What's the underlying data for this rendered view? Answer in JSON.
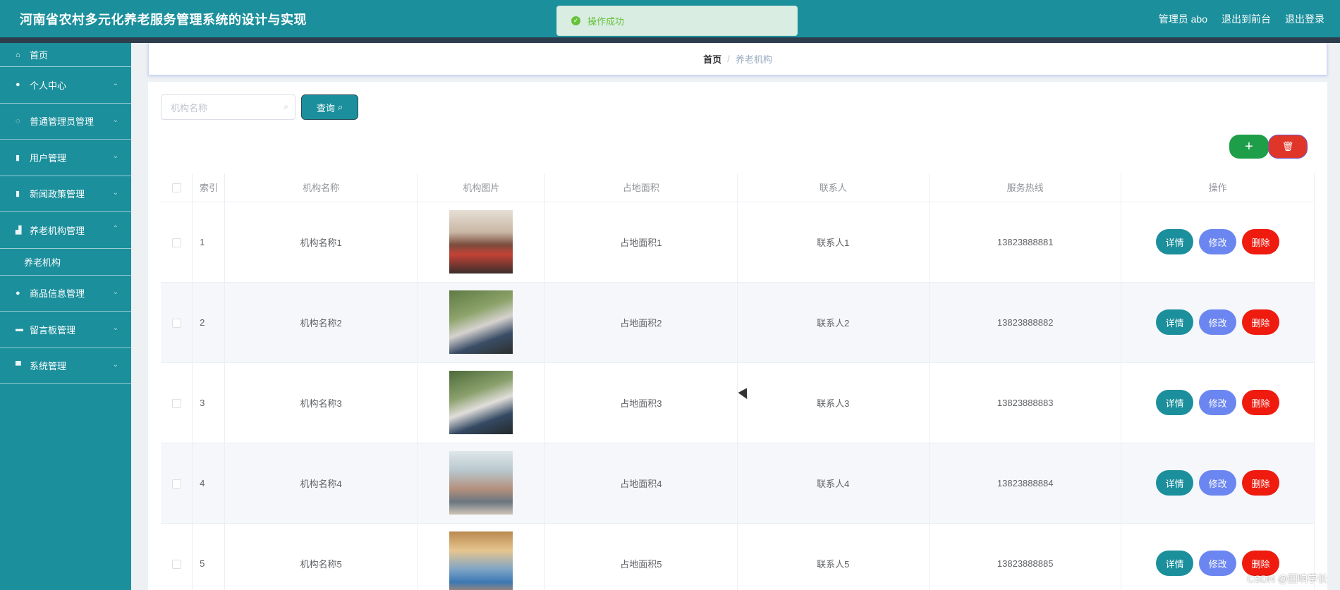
{
  "header": {
    "title": "河南省农村多元化养老服务管理系统的设计与实现",
    "admin_label": "管理员 abo",
    "front_label": "退出到前台",
    "logout_label": "退出登录"
  },
  "toast": {
    "message": "操作成功"
  },
  "sidebar": {
    "home": "首页",
    "items": [
      {
        "label": "个人中心",
        "icon": "user-icon"
      },
      {
        "label": "普通管理员管理",
        "icon": "compass-icon"
      },
      {
        "label": "用户管理",
        "icon": "clipboard-icon"
      },
      {
        "label": "新闻政策管理",
        "icon": "clipboard-icon"
      },
      {
        "label": "养老机构管理",
        "icon": "chart-icon",
        "expanded": true
      },
      {
        "label": "商品信息管理",
        "icon": "user-icon"
      },
      {
        "label": "留言板管理",
        "icon": "briefcase-icon"
      },
      {
        "label": "系统管理",
        "icon": "stamp-icon"
      }
    ],
    "sub_item": "养老机构"
  },
  "breadcrumb": {
    "home": "首页",
    "separator": "/",
    "current": "养老机构"
  },
  "search": {
    "placeholder": "机构名称",
    "button": "查询"
  },
  "table": {
    "headers": [
      "索引",
      "机构名称",
      "机构图片",
      "占地面积",
      "联系人",
      "服务热线",
      "操作"
    ],
    "actions": {
      "detail": "详情",
      "edit": "修改",
      "delete": "删除"
    },
    "rows": [
      {
        "index": "1",
        "name": "机构名称1",
        "area": "占地面积1",
        "contact": "联系人1",
        "phone": "13823888881"
      },
      {
        "index": "2",
        "name": "机构名称2",
        "area": "占地面积2",
        "contact": "联系人2",
        "phone": "13823888882"
      },
      {
        "index": "3",
        "name": "机构名称3",
        "area": "占地面积3",
        "contact": "联系人3",
        "phone": "13823888883"
      },
      {
        "index": "4",
        "name": "机构名称4",
        "area": "占地面积4",
        "contact": "联系人4",
        "phone": "13823888884"
      },
      {
        "index": "5",
        "name": "机构名称5",
        "area": "占地面积5",
        "contact": "联系人5",
        "phone": "13823888885"
      }
    ]
  },
  "watermark": "CSDN @回响学长",
  "colors": {
    "primary": "#1b8f9c",
    "success": "#1e9e49",
    "danger": "#e0362a",
    "edit": "#6b86f0"
  }
}
